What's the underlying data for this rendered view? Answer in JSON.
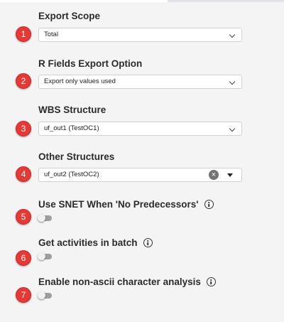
{
  "fields": {
    "export_scope": {
      "badge": "1",
      "label": "Export Scope",
      "value": "Total"
    },
    "r_fields": {
      "badge": "2",
      "label": "R Fields Export Option",
      "value": "Export only values used"
    },
    "wbs": {
      "badge": "3",
      "label": "WBS Structure",
      "value": "uf_out1 (TestOC1)"
    },
    "other": {
      "badge": "4",
      "label": "Other Structures",
      "value": "uf_out2 (TestOC2)"
    }
  },
  "toggles": {
    "use_snet": {
      "badge": "5",
      "label": "Use SNET When 'No Predecessors'",
      "enabled": false
    },
    "batch": {
      "badge": "6",
      "label": "Get activities in batch",
      "enabled": false
    },
    "non_ascii": {
      "badge": "7",
      "label": "Enable non-ascii character analysis",
      "enabled": false
    }
  },
  "icons": {
    "clear": "×",
    "info": "info-icon",
    "dropdown": "chevron-down-icon"
  },
  "colors": {
    "badge": "#e53935",
    "toggle_off": "#9e9e9e"
  }
}
